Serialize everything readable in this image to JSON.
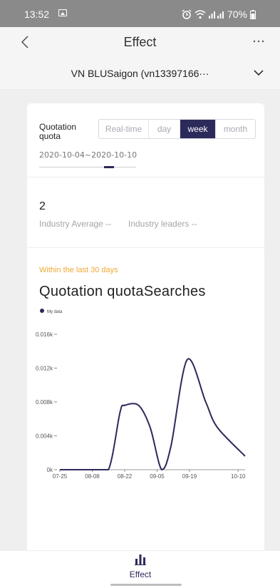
{
  "status_bar": {
    "time": "13:52",
    "battery": "70%"
  },
  "header": {
    "title": "Effect"
  },
  "account": {
    "name": "VN BLUSaigon (vn13397166···"
  },
  "filter": {
    "label": "Quotation quota",
    "tabs": [
      {
        "label": "Real-time",
        "active": false
      },
      {
        "label": "day",
        "active": false
      },
      {
        "label": "week",
        "active": true
      },
      {
        "label": "month",
        "active": false
      }
    ],
    "date_range": "2020-10-04~2020-10-10"
  },
  "metrics": {
    "value": "2",
    "industry_average": "Industry Average --",
    "industry_leaders": "Industry leaders --"
  },
  "chart_section": {
    "period_note": "Within the last 30 days",
    "title": "Quotation quotaSearches"
  },
  "chart_data": {
    "type": "line",
    "title": "Quotation quotaSearches",
    "series": [
      {
        "name": "My data",
        "color": "#2c2a5a",
        "points": [
          {
            "x": "07-25",
            "y": 0
          },
          {
            "x": "08-08",
            "y": 0
          },
          {
            "x": "08-15",
            "y": 0
          },
          {
            "x": "08-20",
            "y": 0.0068
          },
          {
            "x": "08-22",
            "y": 0.0076
          },
          {
            "x": "08-28",
            "y": 0.0076
          },
          {
            "x": "09-02",
            "y": 0.005
          },
          {
            "x": "09-07",
            "y": 0
          },
          {
            "x": "09-11",
            "y": 0.0028
          },
          {
            "x": "09-18",
            "y": 0.013
          },
          {
            "x": "09-26",
            "y": 0.008
          },
          {
            "x": "10-01",
            "y": 0.005
          },
          {
            "x": "10-13",
            "y": 0.0016
          }
        ]
      }
    ],
    "x_ticks": [
      "07-25",
      "08-08",
      "08-22",
      "09-05",
      "09-19",
      "10-10"
    ],
    "y_ticks": [
      "0k",
      "0.004k",
      "0.008k",
      "0.012k",
      "0.016k"
    ],
    "ylim": [
      0,
      0.016
    ],
    "legend": "top-left",
    "grid": false
  },
  "tab_bar": {
    "effect_label": "Effect"
  },
  "colors": {
    "accent": "#2c2a5a",
    "note": "#f0a833"
  }
}
